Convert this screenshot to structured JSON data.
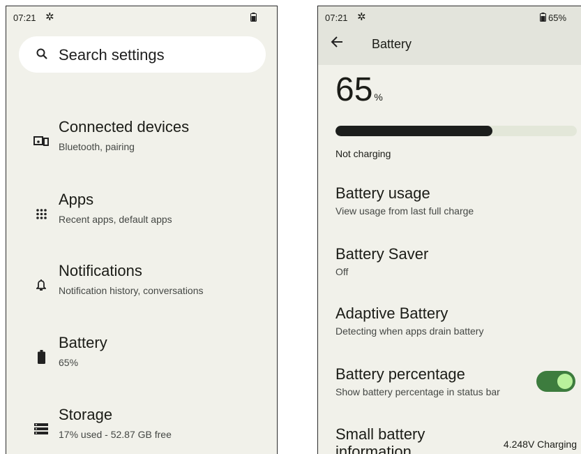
{
  "left_screen": {
    "status": {
      "time": "07:21",
      "gear_icon": "gear-icon",
      "battery_icon": "battery-icon"
    },
    "search": {
      "placeholder": "Search settings",
      "icon": "search-icon"
    },
    "items": [
      {
        "title": "Connected devices",
        "subtitle": "Bluetooth, pairing",
        "icon": "connected-devices-icon"
      },
      {
        "title": "Apps",
        "subtitle": "Recent apps, default apps",
        "icon": "apps-grid-icon"
      },
      {
        "title": "Notifications",
        "subtitle": "Notification history, conversations",
        "icon": "bell-icon"
      },
      {
        "title": "Battery",
        "subtitle": "65%",
        "icon": "battery-icon"
      },
      {
        "title": "Storage",
        "subtitle": "17% used - 52.87 GB free",
        "icon": "storage-icon"
      }
    ]
  },
  "right_screen": {
    "status": {
      "time": "07:21",
      "battery_pct": "65%"
    },
    "appbar": {
      "title": "Battery",
      "back_icon": "back-arrow-icon"
    },
    "level": {
      "value": "65",
      "unit": "%",
      "fraction": 0.65
    },
    "charging_status": "Not charging",
    "items": [
      {
        "title": "Battery usage",
        "subtitle": "View usage from last full charge"
      },
      {
        "title": "Battery Saver",
        "subtitle": "Off"
      },
      {
        "title": "Adaptive Battery",
        "subtitle": "Detecting when apps drain battery"
      },
      {
        "title": "Battery percentage",
        "subtitle": "Show battery percentage in status bar",
        "toggle_on": true
      },
      {
        "title": "Small battery information",
        "value": "4.248V Charging"
      }
    ]
  },
  "colors": {
    "background": "#f1f1ea",
    "appbar": "#e3e4dc",
    "toggle_track": "#3d7c3e",
    "toggle_knob": "#b9f19c",
    "bar_fill": "#1c1e1c"
  }
}
